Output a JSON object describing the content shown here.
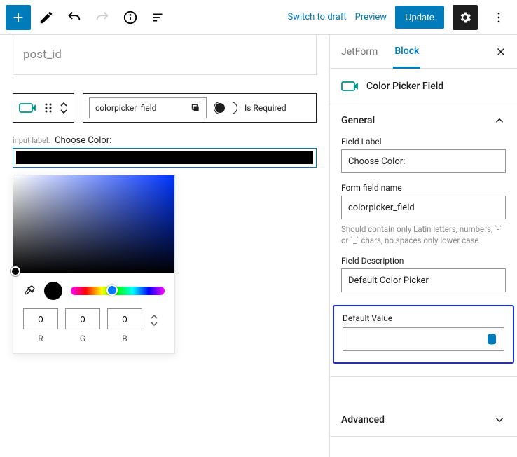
{
  "topbar": {
    "switch_draft": "Switch to draft",
    "preview": "Preview",
    "update": "Update"
  },
  "canvas": {
    "post_title_placeholder": "post_id",
    "field_name": "colorpicker_field",
    "is_required_label": "Is Required",
    "input_label_prefix": "input label:",
    "input_label_value": "Choose Color:",
    "rgb": {
      "r": "0",
      "g": "0",
      "b": "0",
      "r_lbl": "R",
      "g_lbl": "G",
      "b_lbl": "B"
    }
  },
  "sidebar": {
    "tabs": {
      "jetform": "JetForm",
      "block": "Block"
    },
    "block_type": "Color Picker Field",
    "general": {
      "title": "General",
      "field_label_lbl": "Field Label",
      "field_label_val": "Choose Color:",
      "form_field_name_lbl": "Form field name",
      "form_field_name_val": "colorpicker_field",
      "form_field_hint": "Should contain only Latin letters, numbers, `-` or `_` chars, no spaces only lower case",
      "field_desc_lbl": "Field Description",
      "field_desc_val": "Default Color Picker",
      "default_value_lbl": "Default Value"
    },
    "advanced": {
      "title": "Advanced"
    }
  }
}
